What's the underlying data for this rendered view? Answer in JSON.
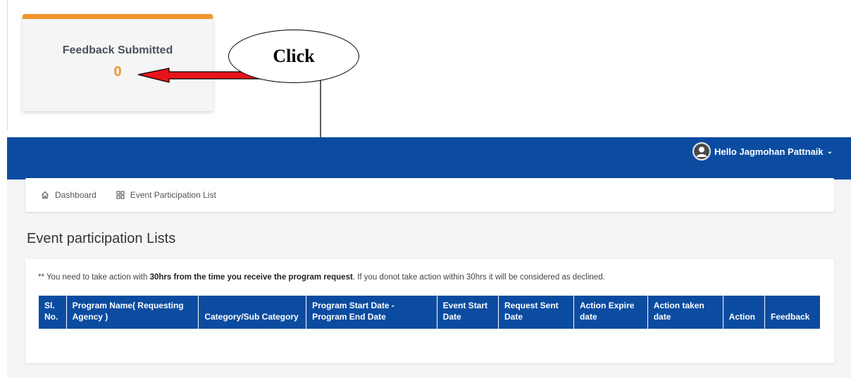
{
  "feedback_card": {
    "title": "Feedback Submitted",
    "count": "0"
  },
  "annotation": {
    "label": "Click"
  },
  "header": {
    "greeting": "Hello Jagmohan Pattnaik",
    "user_icon": "user-avatar-icon",
    "bg_color": "#0b4ca1"
  },
  "breadcrumb": [
    {
      "label": "Dashboard",
      "icon": "home-icon"
    },
    {
      "label": "Event Participation List",
      "icon": "grid-icon"
    }
  ],
  "page": {
    "title": "Event participation Lists",
    "note_prefix": "** You need to take action with ",
    "note_bold": "30hrs from the time you receive the program request",
    "note_suffix": ". If you donot take action within 30hrs it will be considered as declined."
  },
  "table": {
    "columns": [
      "Sl. No.",
      "Program Name( Requesting Agency )",
      "Category/Sub Category",
      "Program Start Date - Program End Date",
      "Event Start Date",
      "Request Sent Date",
      "Action Expire date",
      "Action taken date",
      "Action",
      "Feedback"
    ]
  },
  "colors": {
    "accent": "#f0952b",
    "primary": "#0b4ca1",
    "arrow": "#e8141b"
  }
}
